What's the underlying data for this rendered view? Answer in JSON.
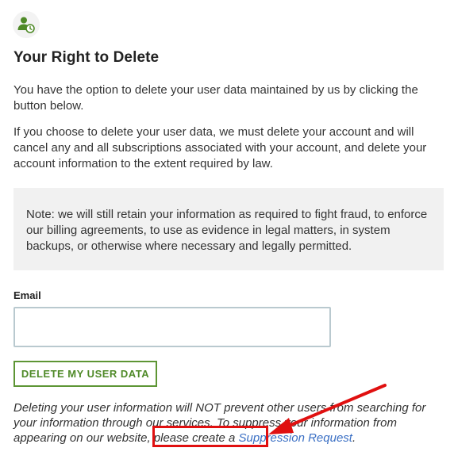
{
  "header": {
    "icon": "user-clock-icon",
    "title": "Your Right to Delete"
  },
  "content": {
    "paragraph1": "You have the option to delete your user data maintained by us by clicking the button below.",
    "paragraph2": "If you choose to delete your user data, we must delete your account and will cancel any and all subscriptions associated with your account, and delete your account information to the extent required by law.",
    "note": "Note: we will still retain your information as required to fight fraud, to enforce our billing agreements, to use as evidence in legal matters, in system backups, or otherwise where necessary and legally permitted."
  },
  "form": {
    "email_label": "Email",
    "email_value": "",
    "email_placeholder": "",
    "delete_button": "DELETE MY USER DATA"
  },
  "footer": {
    "text_before_link": "Deleting your user information will NOT prevent other users from searching for your information through our services. To suppress your information from appearing on our website, please create a ",
    "link_text": "Suppression Request",
    "text_after_link": "."
  },
  "annotations": {
    "highlight_color": "#e01010"
  },
  "colors": {
    "accent_green": "#4f8a28",
    "link_blue": "#3a6fc4",
    "note_background": "#f1f1f1"
  }
}
